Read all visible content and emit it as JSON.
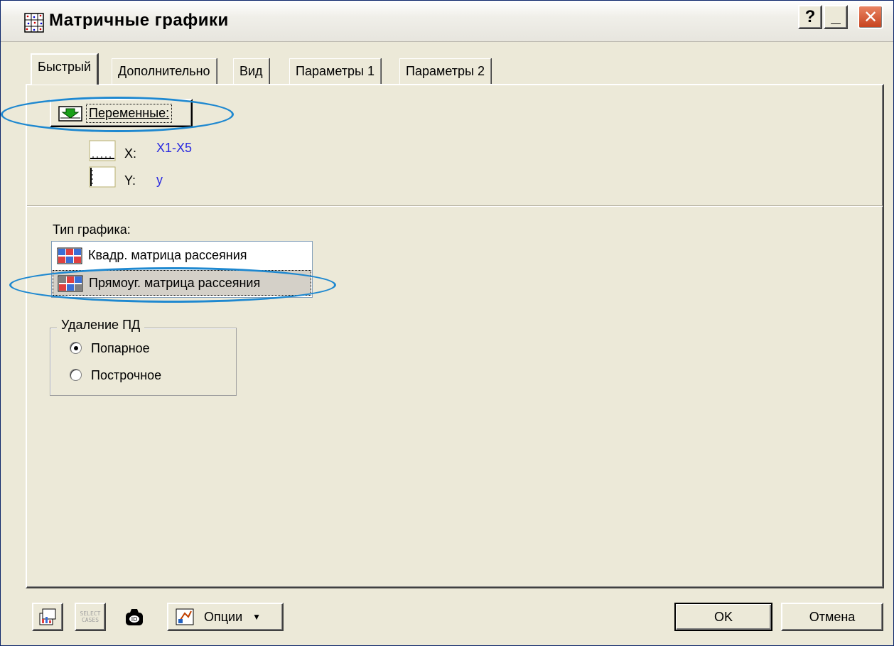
{
  "window": {
    "title": "Матричные графики",
    "buttons": {
      "help": "?",
      "minimize": "_",
      "close": "✕"
    }
  },
  "tabs": [
    {
      "label": "Быстрый",
      "active": true
    },
    {
      "label": "Дополнительно",
      "active": false
    },
    {
      "label": "Вид",
      "active": false
    },
    {
      "label": "Параметры 1",
      "active": false
    },
    {
      "label": "Параметры 2",
      "active": false
    }
  ],
  "variables": {
    "button_label": "Переменные:",
    "x_label": "X:",
    "x_value": "X1-X5",
    "y_label": "Y:",
    "y_value": "y"
  },
  "graph_type": {
    "label": "Тип графика:",
    "options": [
      {
        "label": "Квадр. матрица рассеяния",
        "selected": false
      },
      {
        "label": "Прямоуг. матрица рассеяния",
        "selected": true
      }
    ]
  },
  "missing_data": {
    "title": "Удаление ПД",
    "options": [
      {
        "label": "Попарное",
        "checked": true
      },
      {
        "label": "Построчное",
        "checked": false
      }
    ]
  },
  "footer": {
    "select_cases": "SELECT CASES",
    "options_label": "Опции",
    "ok_label": "OK",
    "cancel_label": "Отмена"
  },
  "colors": {
    "dialog_bg": "#ece9d8",
    "value_text": "#2a2ae0",
    "highlight_ellipse": "#1e88d0"
  }
}
